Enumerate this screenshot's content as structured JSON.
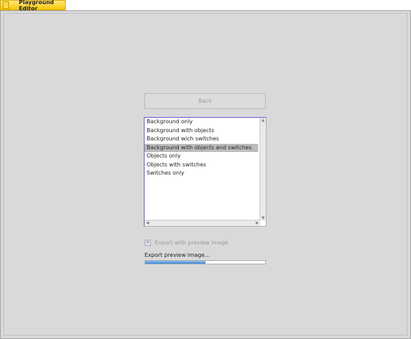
{
  "window": {
    "tab_title": "Playground Editor"
  },
  "back_label": "Back",
  "list": {
    "items": [
      "Background only",
      "Background with objects",
      "Background wich switches",
      "Background with objects and switches",
      "Objects only",
      "Objects with switches",
      "Switches only"
    ],
    "selected_index": 3
  },
  "export_checkbox": {
    "label": "Export with preview image",
    "checked": true,
    "enabled": false
  },
  "progress": {
    "label": "Export preview image...",
    "percent": 50
  },
  "colors": {
    "tab": "#f7c600",
    "progress": "#3d86d8",
    "selection": "#bcbcbc"
  }
}
